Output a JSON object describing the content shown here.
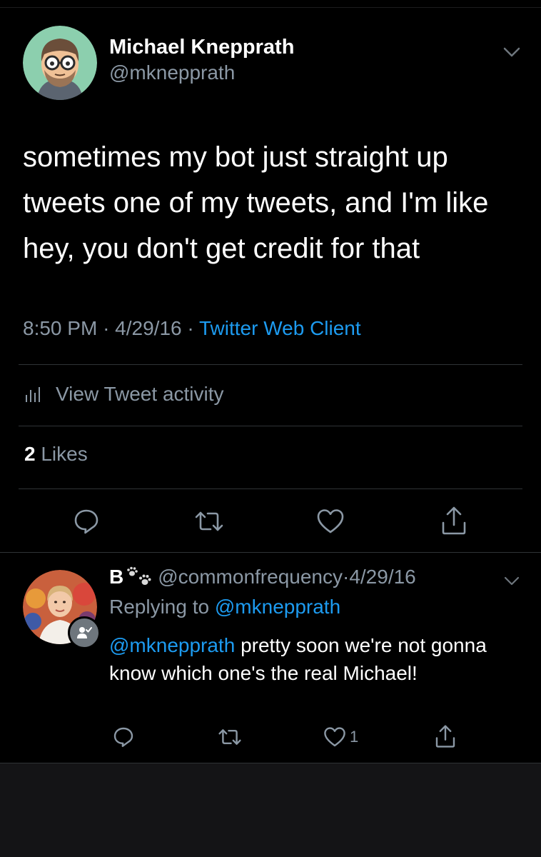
{
  "tweet": {
    "author_name": "Michael Knepprath",
    "author_handle": "@mknepprath",
    "avatar": "cartoon-avatar-glasses-beard",
    "text": "sometimes my bot just straight up tweets one of my tweets, and I'm like hey, you don't get credit for that",
    "time": "8:50 PM",
    "dot": "·",
    "date": "4/29/16",
    "client": "Twitter Web Client",
    "activity_label": "View Tweet activity",
    "likes_count": "2",
    "likes_label": "Likes",
    "icons": {
      "menu": "chevron-down-icon",
      "activity": "activity-bars-icon",
      "reply": "reply-icon",
      "retweet": "retweet-icon",
      "like": "heart-icon",
      "share": "share-icon"
    }
  },
  "reply": {
    "author_name": "B",
    "name_emoji": "paw-prints",
    "author_handle": "@commonfrequency",
    "dot": "·",
    "date": "4/29/16",
    "replying_prefix": "Replying to",
    "replying_to": "@mknepprath",
    "mention": "@mknepprath",
    "text": "pretty soon we're not gonna know which one's the real Michael!",
    "like_count": "1",
    "icons": {
      "menu": "chevron-down-icon",
      "badge": "follows-you-icon",
      "reply": "reply-icon",
      "retweet": "retweet-icon",
      "like": "heart-icon",
      "share": "share-icon"
    }
  },
  "colors": {
    "background": "#000000",
    "text": "#ffffff",
    "secondary": "#8b98a5",
    "link": "#1d9bf0",
    "divider": "#2f3336"
  }
}
